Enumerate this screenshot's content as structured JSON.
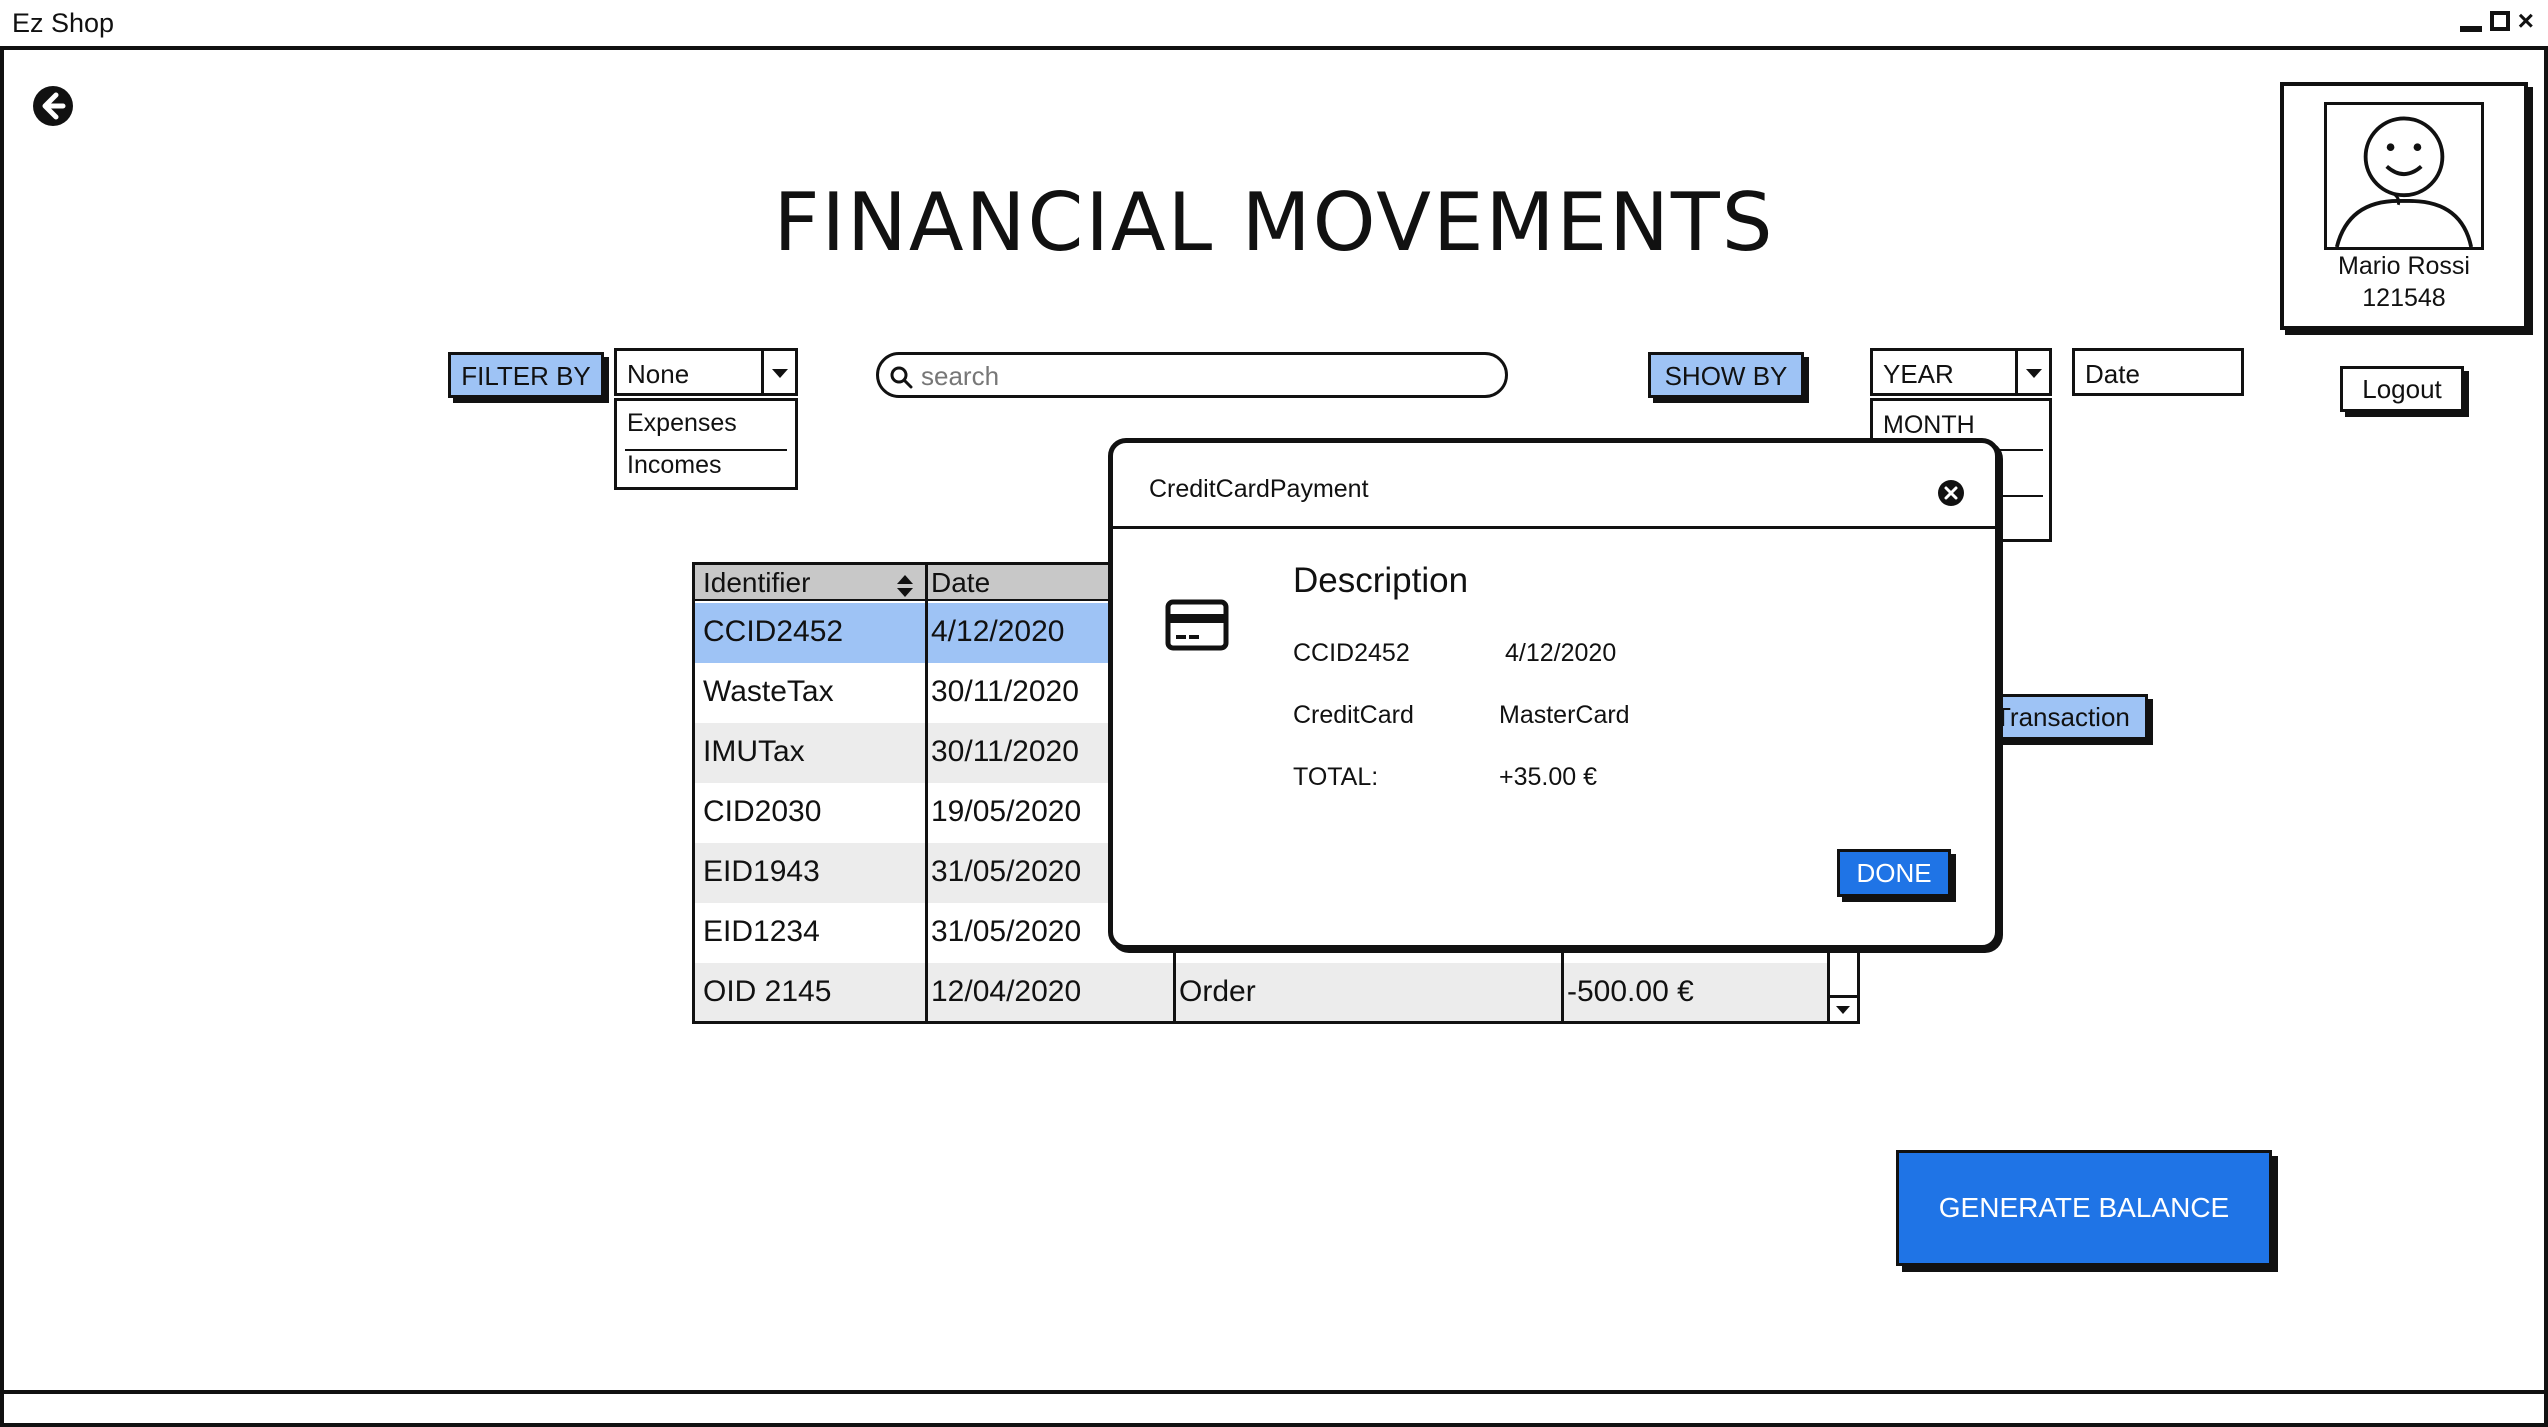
{
  "app": {
    "title": "Ez Shop"
  },
  "page": {
    "title": "FINANCIAL MOVEMENTS"
  },
  "user": {
    "name": "Mario Rossi",
    "id": "121548"
  },
  "header": {
    "logout_label": "Logout"
  },
  "filter": {
    "button_label": "FILTER BY",
    "selected": "None",
    "options": [
      "Expenses",
      "Incomes"
    ]
  },
  "search": {
    "placeholder": "search"
  },
  "show": {
    "button_label": "SHOW BY",
    "selected": "YEAR",
    "options": [
      "MONTH"
    ],
    "date_field": "Date"
  },
  "table": {
    "columns": [
      "Identifier",
      "Date"
    ],
    "rows": [
      {
        "id": "CCID2452",
        "date": "4/12/2020",
        "type": "",
        "amount": ""
      },
      {
        "id": "WasteTax",
        "date": "30/11/2020",
        "type": "",
        "amount": ""
      },
      {
        "id": "IMUTax",
        "date": "30/11/2020",
        "type": "",
        "amount": ""
      },
      {
        "id": "CID2030",
        "date": "19/05/2020",
        "type": "",
        "amount": ""
      },
      {
        "id": "EID1943",
        "date": "31/05/2020",
        "type": "",
        "amount": ""
      },
      {
        "id": "EID1234",
        "date": "31/05/2020",
        "type": "",
        "amount": ""
      },
      {
        "id": "OID 2145",
        "date": "12/04/2020",
        "type": "Order",
        "amount": "-500.00 €"
      }
    ]
  },
  "actions": {
    "transaction_label": "Transaction",
    "generate_balance_label": "GENERATE BALANCE"
  },
  "modal": {
    "title": "CreditCardPayment",
    "heading": "Description",
    "id": "CCID2452",
    "date": "4/12/2020",
    "method_label": "CreditCard",
    "method_value": "MasterCard",
    "total_label": "TOTAL:",
    "total_value": "+35.00 €",
    "done_label": "DONE"
  },
  "colors": {
    "accent_blue": "#1f74e6",
    "light_blue": "#9ec3f5",
    "header_gray": "#c8c8c8",
    "row_alt_gray": "#ececec"
  },
  "icons": [
    "back-arrow-icon",
    "avatar-icon",
    "search-icon",
    "sort-icon",
    "credit-card-icon",
    "close-icon"
  ]
}
